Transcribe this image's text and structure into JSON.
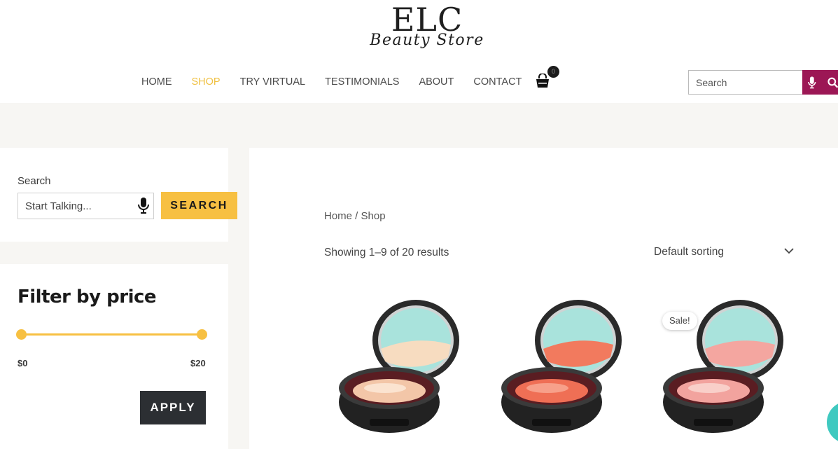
{
  "brand": {
    "name": "ELC",
    "tagline": "Beauty Store"
  },
  "nav": {
    "items": [
      {
        "label": "HOME",
        "active": false
      },
      {
        "label": "SHOP",
        "active": true
      },
      {
        "label": "TRY VIRTUAL",
        "active": false
      },
      {
        "label": "TESTIMONIALS",
        "active": false
      },
      {
        "label": "ABOUT",
        "active": false
      },
      {
        "label": "CONTACT",
        "active": false
      }
    ],
    "cart": {
      "icon": "shopping-bag-icon",
      "count": "0"
    }
  },
  "header_search": {
    "placeholder": "Search",
    "mic_icon": "microphone-icon",
    "search_icon": "magnifier-icon"
  },
  "sidebar": {
    "search_widget": {
      "label": "Search",
      "placeholder": "Start Talking...",
      "mic_icon": "microphone-icon",
      "button_label": "SEARCH"
    },
    "price_filter": {
      "title": "Filter by price",
      "min_label": "$0",
      "max_label": "$20",
      "apply_label": "APPLY"
    }
  },
  "main": {
    "breadcrumb": {
      "home": "Home",
      "separator": " / ",
      "current": "Shop"
    },
    "result_count": "Showing 1–9 of 20 results",
    "sorting": {
      "selected": "Default sorting",
      "icon": "chevron-down-icon"
    },
    "products": [
      {
        "image": "compact-powder-beige",
        "sale": false
      },
      {
        "image": "compact-powder-coral",
        "sale": false
      },
      {
        "image": "compact-powder-pink",
        "sale": true,
        "sale_label": "Sale!"
      }
    ]
  },
  "colors": {
    "accent_yellow": "#f7c042",
    "nav_active": "#f0c040",
    "search_button": "#9c1755",
    "apply_button": "#2c2f33",
    "page_band": "#f7f6f3",
    "chat_bubble": "#3fc9c0"
  }
}
